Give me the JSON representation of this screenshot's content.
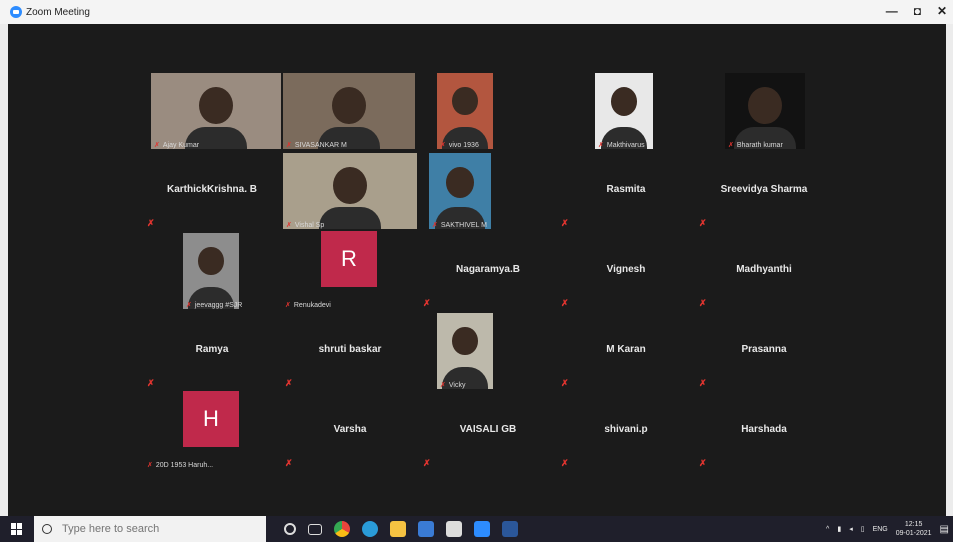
{
  "window": {
    "title": "Zoom Meeting",
    "controls": [
      "—",
      "◘",
      "✕"
    ]
  },
  "participants": [
    {
      "name": "Ajay Kumar",
      "type": "video"
    },
    {
      "name": "SIVASANKAR M",
      "type": "video"
    },
    {
      "name": "vivo 1936",
      "type": "video"
    },
    {
      "name": "Makthivarus",
      "type": "video"
    },
    {
      "name": "Bharath kumar",
      "type": "video"
    },
    {
      "name": "KarthickKrishna. B",
      "type": "text"
    },
    {
      "name": "Vishal Sp",
      "type": "video"
    },
    {
      "name": "SAKTHIVEL M",
      "type": "video"
    },
    {
      "name": "Rasmita",
      "type": "text"
    },
    {
      "name": "Sreevidya Sharma",
      "type": "text"
    },
    {
      "name": "jeevaggg #SJR",
      "type": "video"
    },
    {
      "name": "Renukadevi",
      "type": "avatar",
      "initial": "R"
    },
    {
      "name": "Nagaramya.B",
      "type": "text"
    },
    {
      "name": "Vignesh",
      "type": "text"
    },
    {
      "name": "Madhyanthi",
      "type": "text"
    },
    {
      "name": "Ramya",
      "type": "text"
    },
    {
      "name": "shruti baskar",
      "type": "text"
    },
    {
      "name": "Vicky",
      "type": "video"
    },
    {
      "name": "M Karan",
      "type": "text"
    },
    {
      "name": "Prasanna",
      "type": "text"
    },
    {
      "name": "20D 1953 Haruh...",
      "type": "avatar",
      "initial": "H"
    },
    {
      "name": "Varsha",
      "type": "text"
    },
    {
      "name": "VAISALI GB",
      "type": "text"
    },
    {
      "name": "shivani.p",
      "type": "text"
    },
    {
      "name": "Harshada",
      "type": "text"
    }
  ],
  "taskbar": {
    "search_placeholder": "Type here to search",
    "tray_lang": "ENG",
    "clock_time": "12:15",
    "clock_date": "09-01-2021"
  },
  "colors": {
    "meeting_bg": "#1b1b1b",
    "mic_muted": "#e0342f",
    "avatar_bg": "#c0294b",
    "taskbar": "#1f1f2b"
  },
  "icons": {
    "title": "zoom-app-icon",
    "mic": "mic-muted-icon",
    "taskbar": [
      "cortana-icon",
      "task-view-icon",
      "chrome-icon",
      "edge-icon",
      "file-explorer-icon",
      "mail-icon",
      "store-icon",
      "zoom-icon",
      "word-icon"
    ]
  }
}
